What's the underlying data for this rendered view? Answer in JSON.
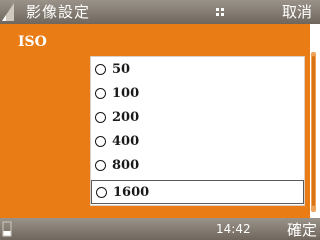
{
  "header": {
    "title": "影像設定",
    "cancel_label": "取消"
  },
  "setting": {
    "label": "ISO",
    "options": [
      "50",
      "100",
      "200",
      "400",
      "800",
      "1600"
    ],
    "selected_value": "1600"
  },
  "footer": {
    "time": "14:42",
    "confirm_label": "確定"
  },
  "colors": {
    "accent": "#ea7c16",
    "bar": "#7f776d"
  },
  "icons": {
    "signal": "signal-strength-icon",
    "menu": "options-menu-icon",
    "battery": "battery-level-icon",
    "radio": "radio-button-icon"
  }
}
